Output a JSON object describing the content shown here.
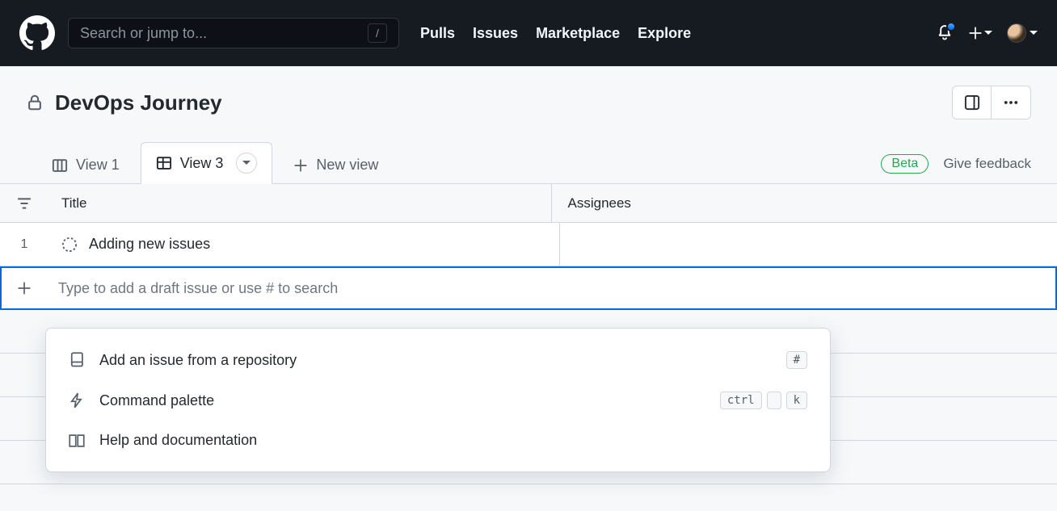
{
  "nav": {
    "search_placeholder": "Search or jump to...",
    "slash_key": "/",
    "links": [
      "Pulls",
      "Issues",
      "Marketplace",
      "Explore"
    ]
  },
  "project": {
    "title": "DevOps Journey",
    "beta_label": "Beta",
    "feedback_label": "Give feedback"
  },
  "tabs": [
    {
      "label": "View 1",
      "active": false
    },
    {
      "label": "View 3",
      "active": true
    }
  ],
  "new_view_label": "New view",
  "columns": {
    "title": "Title",
    "assignees": "Assignees"
  },
  "rows": [
    {
      "num": "1",
      "title": "Adding new issues"
    }
  ],
  "add_placeholder": "Type to add a draft issue or use # to search",
  "dropdown": {
    "items": [
      {
        "label": "Add an issue from a repository",
        "keys": [
          "#"
        ]
      },
      {
        "label": "Command palette",
        "keys": [
          "ctrl",
          "",
          "k"
        ]
      },
      {
        "label": "Help and documentation",
        "keys": []
      }
    ]
  }
}
